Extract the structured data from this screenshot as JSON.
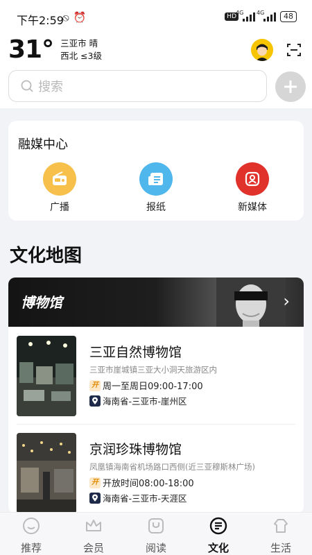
{
  "status_bar": {
    "time": "下午2:59",
    "network_1": "4G",
    "network_2": "4G",
    "hd": "HD",
    "battery": "48"
  },
  "weather": {
    "temperature": "31°",
    "city_weather": "三亚市 晴",
    "wind": "西北 ≤3级"
  },
  "search": {
    "placeholder": "搜索"
  },
  "media_center": {
    "title": "融媒中心",
    "items": [
      {
        "label": "广播",
        "icon": "radio-icon",
        "color": "#f6c04b"
      },
      {
        "label": "报纸",
        "icon": "newspaper-icon",
        "color": "#4fb7ec"
      },
      {
        "label": "新媒体",
        "icon": "new-media-icon",
        "color": "#e0312b"
      }
    ]
  },
  "culture_map": {
    "title": "文化地图",
    "banner_title": "博物馆",
    "museums": [
      {
        "name": "三亚自然博物馆",
        "address": "三亚市崖城镇三亚大小洞天旅游区内",
        "hours": "周一至周日09:00-17:00",
        "region": "海南省-三亚市-崖州区"
      },
      {
        "name": "京润珍珠博物馆",
        "address": "凤凰镇海南省机场路口西侧(近三亚穆斯林广场)",
        "hours": "开放时间08:00-18:00",
        "region": "海南省-三亚市-天涯区"
      }
    ]
  },
  "tabs": [
    {
      "label": "推荐",
      "icon": "recommend-icon",
      "active": false
    },
    {
      "label": "会员",
      "icon": "crown-icon",
      "active": false
    },
    {
      "label": "阅读",
      "icon": "read-icon",
      "active": false
    },
    {
      "label": "文化",
      "icon": "culture-icon",
      "active": true
    },
    {
      "label": "生活",
      "icon": "life-icon",
      "active": false
    }
  ],
  "colors": {
    "accent_active": "#111111",
    "tab_inactive": "#555555",
    "open_tag": "#e08a00"
  }
}
